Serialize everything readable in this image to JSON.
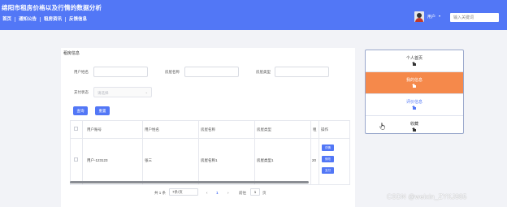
{
  "header": {
    "site_title": "绵阳市租房价格以及行情的数据分析",
    "nav": [
      "首页",
      "通知公告",
      "租房资讯",
      "反馈信息"
    ],
    "user_name": "用户",
    "user_caret": "▾",
    "search_placeholder": "输入关键词"
  },
  "panel": {
    "title": "租房信息",
    "filters": {
      "username_label": "用户姓名",
      "house_name_label": "房屋名称",
      "house_type_label": "房屋类型",
      "pay_status_label": "支付状态",
      "pay_status_placeholder": "请选择"
    },
    "buttons": {
      "query": "查询",
      "reset": "重置"
    },
    "table": {
      "columns": [
        "用户账号",
        "用户姓名",
        "房屋名称",
        "房屋类型",
        "租",
        "操作"
      ],
      "rows": [
        {
          "account": "用户-123123",
          "name": "张三",
          "house_name": "房屋名称1",
          "house_type": "房屋类型1",
          "rent": "20",
          "actions": [
            "详情",
            "修改",
            "支付"
          ]
        }
      ]
    },
    "pagination": {
      "total": "共 1 条",
      "page_size": "7条/页",
      "prev": "‹",
      "current_page": "1",
      "next": "›",
      "goto_label": "前往",
      "goto_value": "1",
      "page_unit": "页"
    }
  },
  "side_menu": {
    "items": [
      {
        "label": "个人首页",
        "active": false,
        "color": "#333333"
      },
      {
        "label": "我的信息",
        "active": true,
        "color": "#ffffff"
      },
      {
        "label": "评价信息",
        "active": false,
        "color": "#5277f6"
      },
      {
        "label": "收藏",
        "active": false,
        "color": "#333333"
      }
    ],
    "active_bg": "#f5894b"
  },
  "colors": {
    "primary": "#5277f6",
    "accent": "#f5894b"
  },
  "watermark": "CSDN @weixin_ZYKJ985"
}
